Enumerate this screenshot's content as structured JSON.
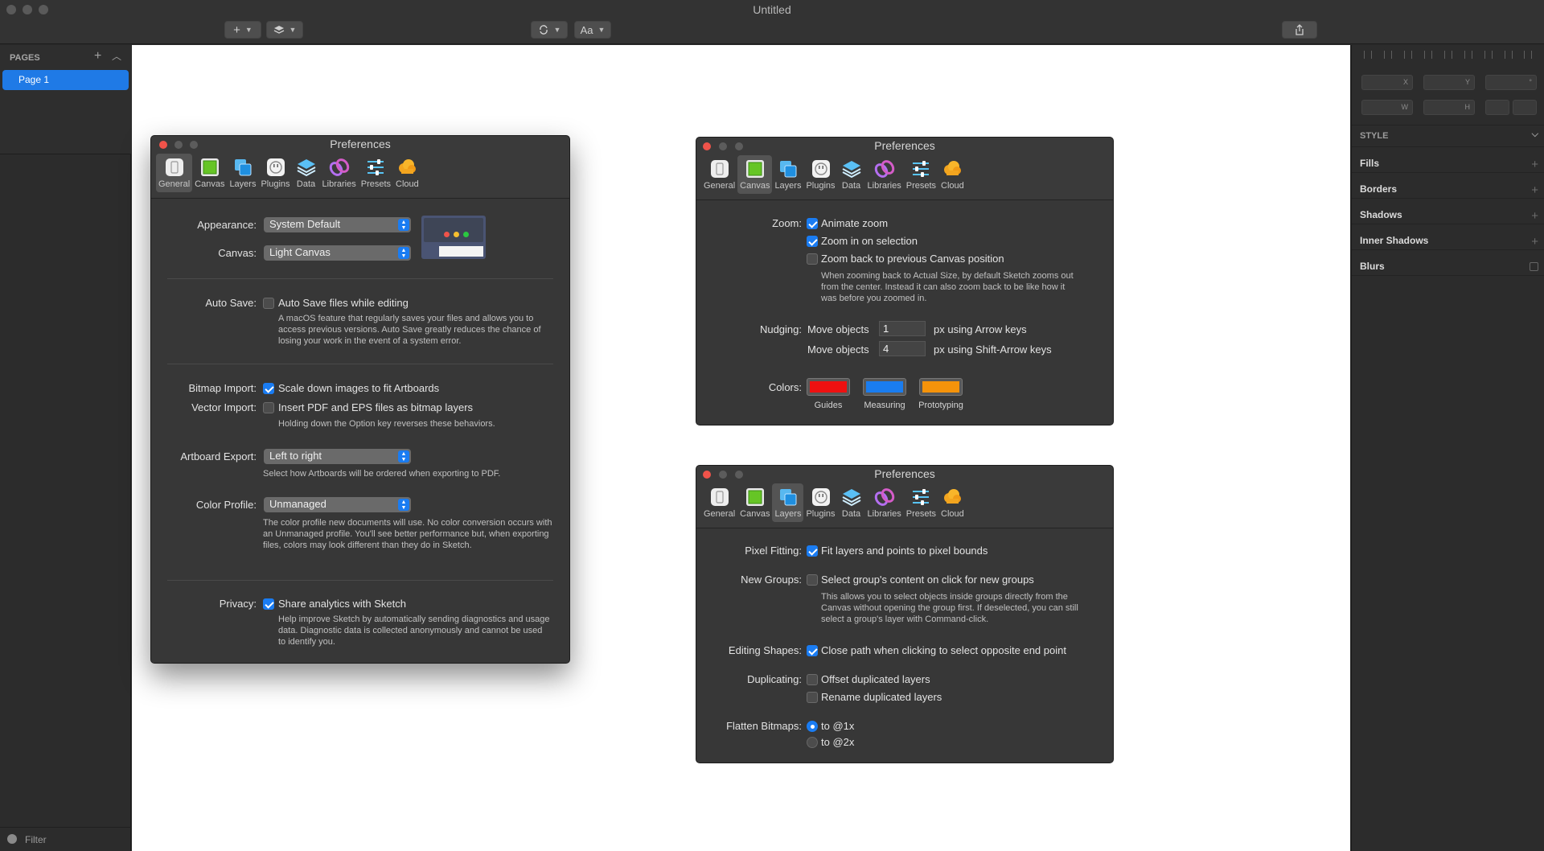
{
  "window": {
    "title": "Untitled"
  },
  "toolbar": {
    "insert_label": "+",
    "text_label": "Aa"
  },
  "sidebar": {
    "pages_label": "PAGES",
    "pages": [
      "Page 1"
    ],
    "filter_label": "Filter"
  },
  "inspector": {
    "fields": {
      "x": "X",
      "y": "Y",
      "rotation": "°",
      "width": "W",
      "height": "H"
    },
    "style_label": "STYLE",
    "rows": [
      "Fills",
      "Borders",
      "Shadows",
      "Inner Shadows",
      "Blurs"
    ]
  },
  "colors": {
    "accent": "#1a7cf2",
    "guides": "#ee1111",
    "measuring": "#1a7df0",
    "prototyping": "#f5930a",
    "close_button": "#f0534a"
  },
  "tabs": [
    {
      "label": "General",
      "icon": "phone-icon"
    },
    {
      "label": "Canvas",
      "icon": "canvas-square-icon"
    },
    {
      "label": "Layers",
      "icon": "layers-icon"
    },
    {
      "label": "Plugins",
      "icon": "plug-icon"
    },
    {
      "label": "Data",
      "icon": "data-stack-icon"
    },
    {
      "label": "Libraries",
      "icon": "link-icon"
    },
    {
      "label": "Presets",
      "icon": "sliders-icon"
    },
    {
      "label": "Cloud",
      "icon": "cloud-icon"
    }
  ],
  "general": {
    "title": "Preferences",
    "appearance_label": "Appearance:",
    "appearance_value": "System Default",
    "canvas_label": "Canvas:",
    "canvas_value": "Light Canvas",
    "autosave_label": "Auto Save:",
    "autosave_option": "Auto Save files while editing",
    "autosave_checked": false,
    "autosave_hint": "A macOS feature that regularly saves your files and allows you to access previous versions. Auto Save greatly reduces the chance of losing your work in the event of a system error.",
    "bitmap_label": "Bitmap Import:",
    "bitmap_option": "Scale down images to fit Artboards",
    "bitmap_checked": true,
    "vector_label": "Vector Import:",
    "vector_option": "Insert PDF and EPS files as bitmap layers",
    "vector_checked": false,
    "import_hint": "Holding down the Option key reverses these behaviors.",
    "export_label": "Artboard Export:",
    "export_value": "Left to right",
    "export_hint": "Select how Artboards will be ordered when exporting to PDF.",
    "profile_label": "Color Profile:",
    "profile_value": "Unmanaged",
    "profile_hint": "The color profile new documents will use. No color conversion occurs with an Unmanaged profile. You'll see better performance but, when exporting files, colors may look different than they do in Sketch.",
    "privacy_label": "Privacy:",
    "privacy_option": "Share analytics with Sketch",
    "privacy_checked": true,
    "privacy_hint": "Help improve Sketch by automatically sending diagnostics and usage data. Diagnostic data is collected anonymously and cannot be used to identify you."
  },
  "canvas": {
    "title": "Preferences",
    "zoom_label": "Zoom:",
    "zoom_options": [
      {
        "label": "Animate zoom",
        "checked": true
      },
      {
        "label": "Zoom in on selection",
        "checked": true
      },
      {
        "label": "Zoom back to previous Canvas position",
        "checked": false
      }
    ],
    "zoom_hint": "When zooming back to Actual Size, by default Sketch zooms out from the center. Instead it can also zoom back to be like how it was before you zoomed in.",
    "nudging_label": "Nudging:",
    "nudge_prefix": "Move objects",
    "nudge_small": "1",
    "nudge_small_suffix": "px using Arrow keys",
    "nudge_large": "4",
    "nudge_large_suffix": "px using Shift-Arrow keys",
    "colors_label": "Colors:",
    "swatch_labels": [
      "Guides",
      "Measuring",
      "Prototyping"
    ]
  },
  "layers": {
    "title": "Preferences",
    "pixel_label": "Pixel Fitting:",
    "pixel_option": "Fit layers and points to pixel bounds",
    "pixel_checked": true,
    "groups_label": "New Groups:",
    "groups_option": "Select group's content on click for new groups",
    "groups_checked": false,
    "groups_hint": "This allows you to select objects inside groups directly from the Canvas without opening the group first. If deselected, you can still select a group's layer with Command-click.",
    "editing_label": "Editing Shapes:",
    "editing_option": "Close path when clicking to select opposite end point",
    "editing_checked": true,
    "dup_label": "Duplicating:",
    "dup_offset": "Offset duplicated layers",
    "dup_offset_checked": false,
    "dup_rename": "Rename duplicated layers",
    "dup_rename_checked": false,
    "flatten_label": "Flatten Bitmaps:",
    "flatten_1x": "to @1x",
    "flatten_2x": "to @2x",
    "flatten_selected": "to @1x"
  }
}
